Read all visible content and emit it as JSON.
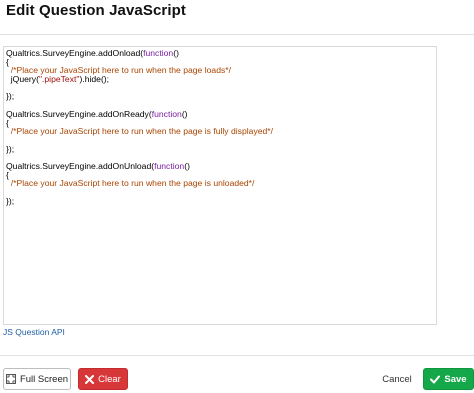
{
  "dialog": {
    "title": "Edit Question JavaScript"
  },
  "editor": {
    "lines": [
      [
        {
          "t": "Qualtrics.SurveyEngine.addOnload(",
          "c": ""
        },
        {
          "t": "function",
          "c": "kw"
        },
        {
          "t": "()",
          "c": ""
        }
      ],
      [
        {
          "t": "{",
          "c": ""
        }
      ],
      [
        {
          "t": "  /*Place your JavaScript here to run when the page loads*/",
          "c": "cm"
        }
      ],
      [
        {
          "t": "  jQuery(",
          "c": ""
        },
        {
          "t": "\".pipeText\"",
          "c": "str"
        },
        {
          "t": ").hide();",
          "c": ""
        }
      ],
      [
        {
          "t": "",
          "c": ""
        }
      ],
      [
        {
          "t": "});",
          "c": ""
        }
      ],
      [
        {
          "t": "",
          "c": ""
        }
      ],
      [
        {
          "t": "Qualtrics.SurveyEngine.addOnReady(",
          "c": ""
        },
        {
          "t": "function",
          "c": "kw"
        },
        {
          "t": "()",
          "c": ""
        }
      ],
      [
        {
          "t": "{",
          "c": ""
        }
      ],
      [
        {
          "t": "  /*Place your JavaScript here to run when the page is fully displayed*/",
          "c": "cm"
        }
      ],
      [
        {
          "t": "",
          "c": ""
        }
      ],
      [
        {
          "t": "});",
          "c": ""
        }
      ],
      [
        {
          "t": "",
          "c": ""
        }
      ],
      [
        {
          "t": "Qualtrics.SurveyEngine.addOnUnload(",
          "c": ""
        },
        {
          "t": "function",
          "c": "kw"
        },
        {
          "t": "()",
          "c": ""
        }
      ],
      [
        {
          "t": "{",
          "c": ""
        }
      ],
      [
        {
          "t": "  /*Place your JavaScript here to run when the page is unloaded*/",
          "c": "cm"
        }
      ],
      [
        {
          "t": "",
          "c": ""
        }
      ],
      [
        {
          "t": "});",
          "c": ""
        }
      ]
    ],
    "colors": {
      "keyword": "#7a1fa2",
      "comment": "#a94400",
      "string": "#a11010"
    }
  },
  "links": {
    "api_label": "JS Question API"
  },
  "footer": {
    "fullscreen_label": "Full Screen",
    "fullscreen_icon": "fullscreen-icon",
    "clear_label": "Clear",
    "clear_icon": "x-icon",
    "cancel_label": "Cancel",
    "save_label": "Save",
    "save_icon": "checkmark-icon"
  },
  "colors": {
    "clear_bg": "#d8373a",
    "save_bg": "#15a84b",
    "link": "#1f5fa8"
  }
}
